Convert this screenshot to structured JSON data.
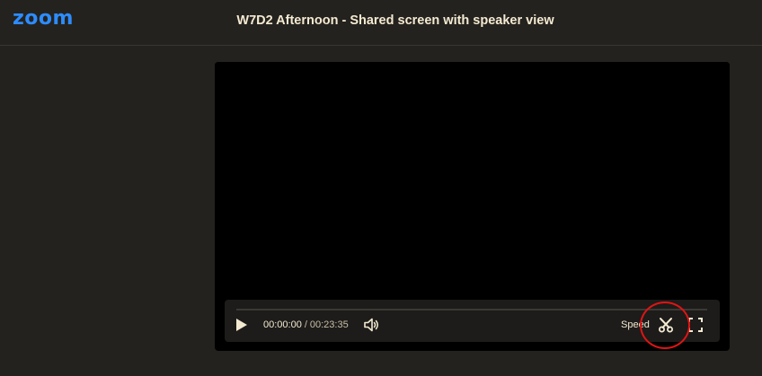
{
  "header": {
    "logo": "zoom",
    "title": "W7D2 Afternoon - Shared screen with speaker view"
  },
  "player": {
    "current_time": "00:00:00",
    "separator": "/",
    "duration": "00:23:35",
    "progress_fraction": 0,
    "speed_label": "Speed"
  },
  "icons": {
    "play": "play-icon",
    "volume": "volume-icon",
    "clip": "scissors-icon",
    "fullscreen": "fullscreen-icon"
  },
  "colors": {
    "brand": "#2d8cff",
    "background": "#24221e",
    "text": "#f4ead2",
    "annotation": "#e01414"
  }
}
